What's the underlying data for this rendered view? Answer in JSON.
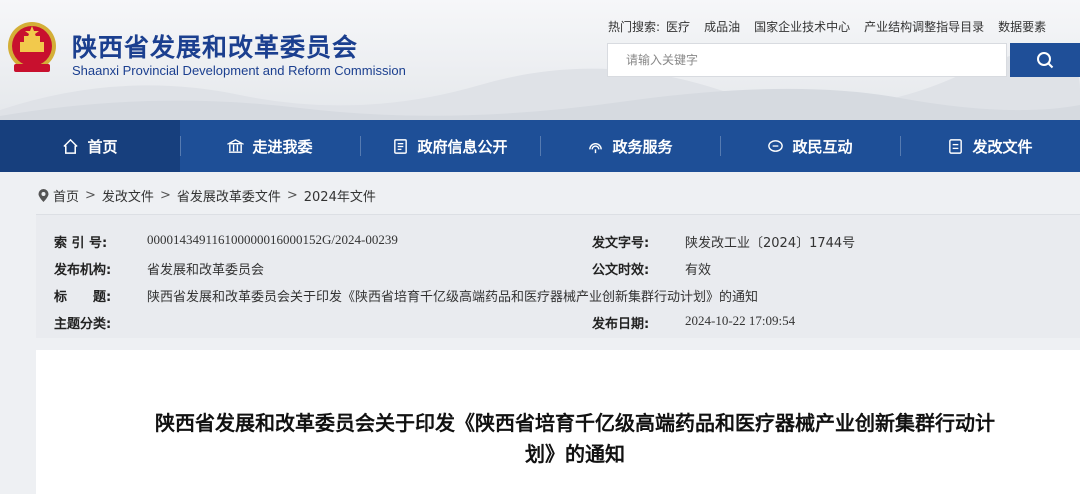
{
  "site": {
    "title": "陕西省发展和改革委员会",
    "subtitle": "Shaanxi Provincial Development and Reform Commission"
  },
  "hot_search": {
    "label": "热门搜索:",
    "keywords": [
      "医疗",
      "成品油",
      "国家企业技术中心",
      "产业结构调整指导目录",
      "数据要素"
    ]
  },
  "search": {
    "placeholder": "请输入关键字"
  },
  "nav": [
    {
      "label": "首页",
      "icon": "home-icon"
    },
    {
      "label": "走进我委",
      "icon": "building-icon"
    },
    {
      "label": "政府信息公开",
      "icon": "document-icon"
    },
    {
      "label": "政务服务",
      "icon": "service-icon"
    },
    {
      "label": "政民互动",
      "icon": "chat-icon"
    },
    {
      "label": "发改文件",
      "icon": "file-icon"
    }
  ],
  "breadcrumb": [
    "首页",
    "发改文件",
    "省发展改革委文件",
    "2024年文件"
  ],
  "meta": {
    "index_label": "索 引 号:",
    "index_value": "000014349116100000016000152G/2024-00239",
    "doc_no_label": "发文字号:",
    "doc_no_value": "陕发改工业〔2024〕1744号",
    "issuer_label": "发布机构:",
    "issuer_value": "省发展和改革委员会",
    "validity_label": "公文时效:",
    "validity_value": "有效",
    "title_label": "标　　题:",
    "title_value": "陕西省发展和改革委员会关于印发《陕西省培育千亿级高端药品和医疗器械产业创新集群行动计划》的通知",
    "category_label": "主题分类:",
    "category_value": "",
    "date_label": "发布日期:",
    "date_value": "2024-10-22 17:09:54"
  },
  "article": {
    "title_line1": "陕西省发展和改革委员会关于印发《陕西省培育千亿级高端药品和医疗器械产业创新集群行动计",
    "title_line2": "划》的通知"
  },
  "colors": {
    "brand": "#1e4f97",
    "nav_active": "#173f7d",
    "title": "#1b3f8f"
  }
}
